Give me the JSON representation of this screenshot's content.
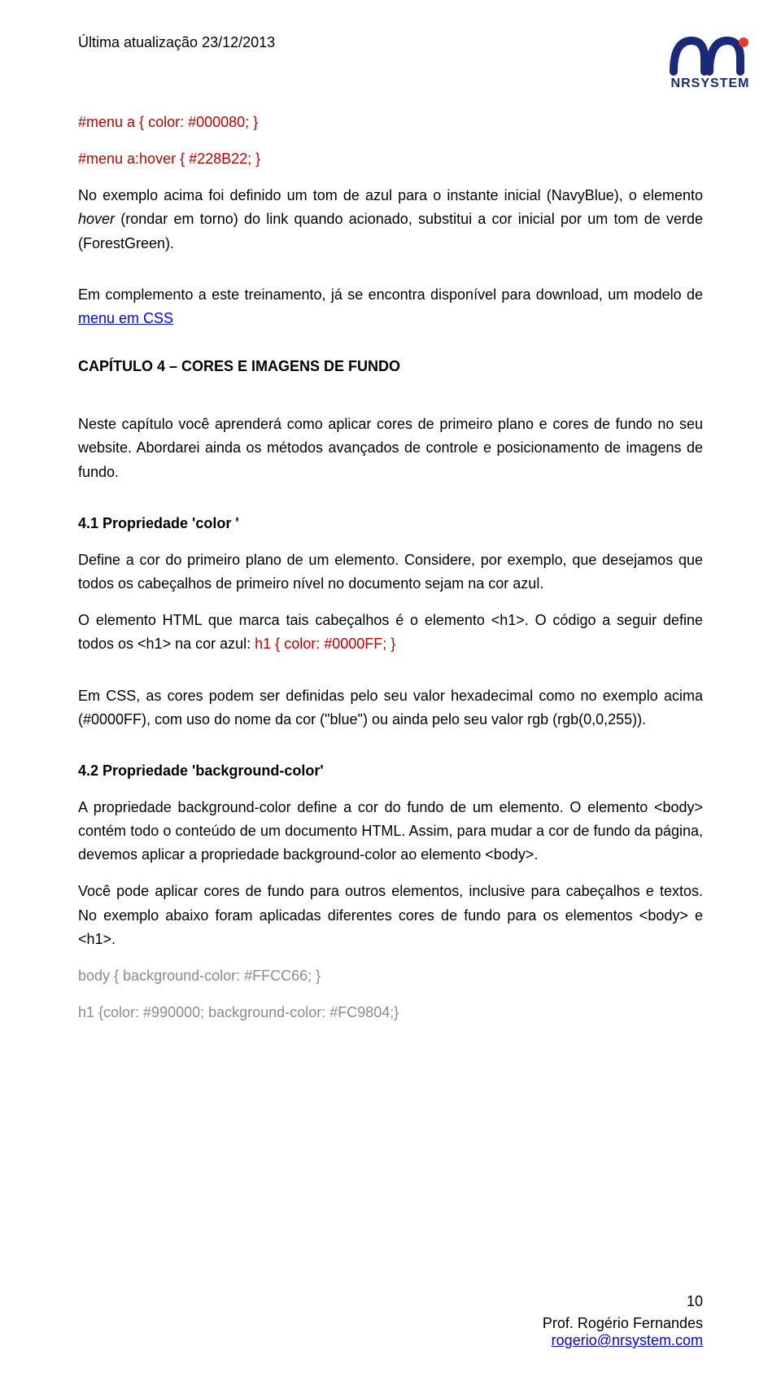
{
  "header": {
    "update_label": "Última atualização 23/12/2013",
    "logo_name": "NRSYSTEM"
  },
  "body": {
    "code_line1": "#menu a { color: #000080; }",
    "code_line2": "#menu a:hover { #228B22; }",
    "p1_a": "No exemplo acima foi definido um tom de azul para o instante inicial (NavyBlue), o elemento ",
    "p1_hover": "hover",
    "p1_b": " (rondar em torno) do link quando acionado, substitui a cor inicial por um tom de verde (ForestGreen).",
    "p2_a": "Em complemento a este treinamento, já se encontra disponível para download, um modelo de ",
    "p2_link": " menu em CSS",
    "chapter": "CAPÍTULO 4 – CORES E IMAGENS DE FUNDO",
    "p3": "Neste capítulo você aprenderá como aplicar cores de primeiro plano e cores de fundo no seu website. Abordarei ainda os métodos avançados de controle e posicionamento de imagens de fundo.",
    "sub41": "4.1 Propriedade 'color '",
    "p4": "Define a cor do primeiro plano de um elemento. Considere, por exemplo, que desejamos que todos os cabeçalhos de primeiro nível no documento sejam na cor azul.",
    "p5_a": "O elemento HTML que marca tais cabeçalhos é o elemento <h1>. O código a seguir define todos os <h1> na cor azul: ",
    "p5_code": "h1 { color: #0000FF; }",
    "p6": "Em CSS, as cores podem ser definidas pelo seu valor hexadecimal como no exemplo acima (#0000FF), com uso do nome da cor (\"blue\") ou ainda pelo seu valor rgb (rgb(0,0,255)).",
    "sub42": "4.2 Propriedade 'background-color'",
    "p7": "A propriedade background-color define a cor do fundo de um elemento. O elemento <body> contém todo o conteúdo de um documento HTML. Assim, para mudar a cor de fundo da página, devemos aplicar a propriedade background-color ao elemento <body>.",
    "p8": "Você pode aplicar cores de fundo para outros elementos, inclusive para cabeçalhos e textos. No exemplo abaixo foram aplicadas diferentes cores de fundo para os elementos <body> e <h1>.",
    "code_body": "body { background-color: #FFCC66; }",
    "code_h1": "h1 {color: #990000; background-color: #FC9804;}"
  },
  "footer": {
    "page_number": "10",
    "prof": "Prof. Rogério Fernandes",
    "email": "rogerio@nrsystem.com"
  }
}
